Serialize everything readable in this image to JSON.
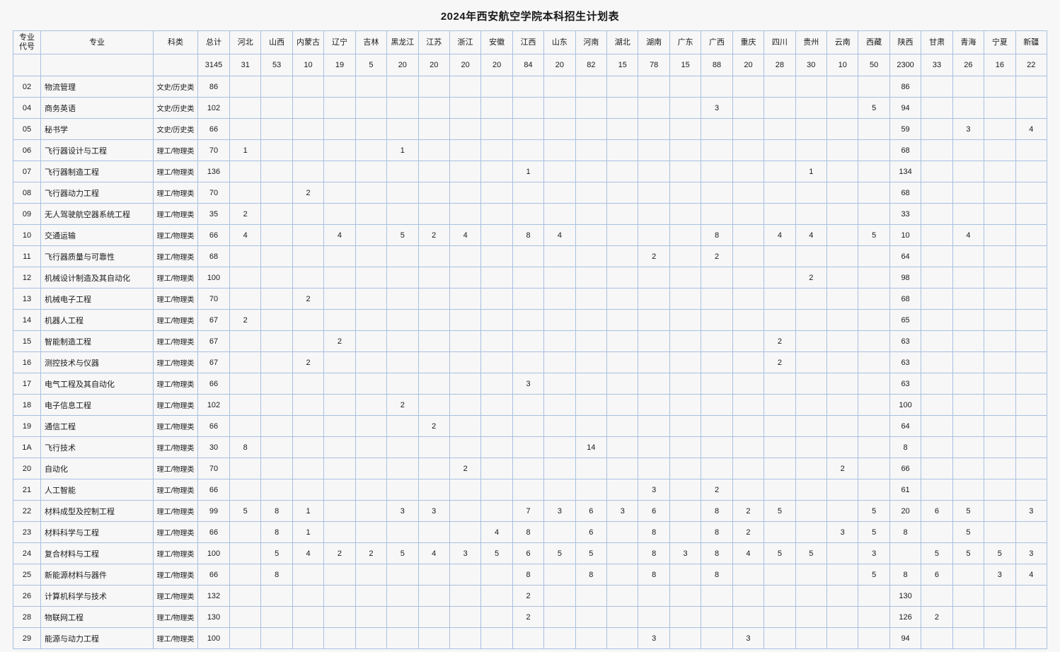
{
  "title": "2024年西安航空学院本科招生计划表",
  "columns": {
    "code": "专业\n代号",
    "code_line1": "专业",
    "code_line2": "代号",
    "major": "专业",
    "category": "科类",
    "total": "总计",
    "provinces": [
      "河北",
      "山西",
      "内蒙古",
      "辽宁",
      "吉林",
      "黑龙江",
      "江苏",
      "浙江",
      "安徽",
      "江西",
      "山东",
      "河南",
      "湖北",
      "湖南",
      "广东",
      "广西",
      "重庆",
      "四川",
      "贵州",
      "云南",
      "西藏",
      "陕西",
      "甘肃",
      "青海",
      "宁夏",
      "新疆"
    ]
  },
  "summary_row": {
    "code": "",
    "major": "",
    "category": "",
    "total": "3145",
    "values": [
      "31",
      "53",
      "10",
      "19",
      "5",
      "20",
      "20",
      "20",
      "20",
      "84",
      "20",
      "82",
      "15",
      "78",
      "15",
      "88",
      "20",
      "28",
      "30",
      "10",
      "50",
      "2300",
      "33",
      "26",
      "16",
      "22"
    ]
  },
  "rows": [
    {
      "code": "02",
      "major": "物流管理",
      "category": "文史/历史类",
      "total": "86",
      "values": [
        "",
        "",
        "",
        "",
        "",
        "",
        "",
        "",
        "",
        "",
        "",
        "",
        "",
        "",
        "",
        "",
        "",
        "",
        "",
        "",
        "",
        "86",
        "",
        "",
        "",
        ""
      ]
    },
    {
      "code": "04",
      "major": "商务英语",
      "category": "文史/历史类",
      "total": "102",
      "values": [
        "",
        "",
        "",
        "",
        "",
        "",
        "",
        "",
        "",
        "",
        "",
        "",
        "",
        "",
        "",
        "3",
        "",
        "",
        "",
        "",
        "5",
        "94",
        "",
        "",
        "",
        ""
      ]
    },
    {
      "code": "05",
      "major": "秘书学",
      "category": "文史/历史类",
      "total": "66",
      "values": [
        "",
        "",
        "",
        "",
        "",
        "",
        "",
        "",
        "",
        "",
        "",
        "",
        "",
        "",
        "",
        "",
        "",
        "",
        "",
        "",
        "",
        "59",
        "",
        "3",
        "",
        "4"
      ]
    },
    {
      "code": "06",
      "major": "飞行器设计与工程",
      "category": "理工/物理类",
      "total": "70",
      "values": [
        "1",
        "",
        "",
        "",
        "",
        "1",
        "",
        "",
        "",
        "",
        "",
        "",
        "",
        "",
        "",
        "",
        "",
        "",
        "",
        "",
        "",
        "68",
        "",
        "",
        "",
        ""
      ]
    },
    {
      "code": "07",
      "major": "飞行器制造工程",
      "category": "理工/物理类",
      "total": "136",
      "values": [
        "",
        "",
        "",
        "",
        "",
        "",
        "",
        "",
        "",
        "1",
        "",
        "",
        "",
        "",
        "",
        "",
        "",
        "",
        "1",
        "",
        "",
        "134",
        "",
        "",
        "",
        ""
      ]
    },
    {
      "code": "08",
      "major": "飞行器动力工程",
      "category": "理工/物理类",
      "total": "70",
      "values": [
        "",
        "",
        "2",
        "",
        "",
        "",
        "",
        "",
        "",
        "",
        "",
        "",
        "",
        "",
        "",
        "",
        "",
        "",
        "",
        "",
        "",
        "68",
        "",
        "",
        "",
        ""
      ]
    },
    {
      "code": "09",
      "major": "无人驾驶航空器系统工程",
      "category": "理工/物理类",
      "total": "35",
      "values": [
        "2",
        "",
        "",
        "",
        "",
        "",
        "",
        "",
        "",
        "",
        "",
        "",
        "",
        "",
        "",
        "",
        "",
        "",
        "",
        "",
        "",
        "33",
        "",
        "",
        "",
        ""
      ]
    },
    {
      "code": "10",
      "major": "交通运输",
      "category": "理工/物理类",
      "total": "66",
      "values": [
        "4",
        "",
        "",
        "4",
        "",
        "5",
        "2",
        "4",
        "",
        "8",
        "4",
        "",
        "",
        "",
        "",
        "8",
        "",
        "4",
        "4",
        "",
        "5",
        "10",
        "",
        "4",
        "",
        ""
      ]
    },
    {
      "code": "11",
      "major": "飞行器质量与可靠性",
      "category": "理工/物理类",
      "total": "68",
      "values": [
        "",
        "",
        "",
        "",
        "",
        "",
        "",
        "",
        "",
        "",
        "",
        "",
        "",
        "2",
        "",
        "2",
        "",
        "",
        "",
        "",
        "",
        "64",
        "",
        "",
        "",
        ""
      ]
    },
    {
      "code": "12",
      "major": "机械设计制造及其自动化",
      "category": "理工/物理类",
      "total": "100",
      "values": [
        "",
        "",
        "",
        "",
        "",
        "",
        "",
        "",
        "",
        "",
        "",
        "",
        "",
        "",
        "",
        "",
        "",
        "",
        "2",
        "",
        "",
        "98",
        "",
        "",
        "",
        ""
      ]
    },
    {
      "code": "13",
      "major": "机械电子工程",
      "category": "理工/物理类",
      "total": "70",
      "values": [
        "",
        "",
        "2",
        "",
        "",
        "",
        "",
        "",
        "",
        "",
        "",
        "",
        "",
        "",
        "",
        "",
        "",
        "",
        "",
        "",
        "",
        "68",
        "",
        "",
        "",
        ""
      ]
    },
    {
      "code": "14",
      "major": "机器人工程",
      "category": "理工/物理类",
      "total": "67",
      "values": [
        "2",
        "",
        "",
        "",
        "",
        "",
        "",
        "",
        "",
        "",
        "",
        "",
        "",
        "",
        "",
        "",
        "",
        "",
        "",
        "",
        "",
        "65",
        "",
        "",
        "",
        ""
      ]
    },
    {
      "code": "15",
      "major": "智能制造工程",
      "category": "理工/物理类",
      "total": "67",
      "values": [
        "",
        "",
        "",
        "2",
        "",
        "",
        "",
        "",
        "",
        "",
        "",
        "",
        "",
        "",
        "",
        "",
        "",
        "2",
        "",
        "",
        "",
        "63",
        "",
        "",
        "",
        ""
      ]
    },
    {
      "code": "16",
      "major": "测控技术与仪器",
      "category": "理工/物理类",
      "total": "67",
      "values": [
        "",
        "",
        "2",
        "",
        "",
        "",
        "",
        "",
        "",
        "",
        "",
        "",
        "",
        "",
        "",
        "",
        "",
        "2",
        "",
        "",
        "",
        "63",
        "",
        "",
        "",
        ""
      ]
    },
    {
      "code": "17",
      "major": "电气工程及其自动化",
      "category": "理工/物理类",
      "total": "66",
      "values": [
        "",
        "",
        "",
        "",
        "",
        "",
        "",
        "",
        "",
        "3",
        "",
        "",
        "",
        "",
        "",
        "",
        "",
        "",
        "",
        "",
        "",
        "63",
        "",
        "",
        "",
        ""
      ]
    },
    {
      "code": "18",
      "major": "电子信息工程",
      "category": "理工/物理类",
      "total": "102",
      "values": [
        "",
        "",
        "",
        "",
        "",
        "2",
        "",
        "",
        "",
        "",
        "",
        "",
        "",
        "",
        "",
        "",
        "",
        "",
        "",
        "",
        "",
        "100",
        "",
        "",
        "",
        ""
      ]
    },
    {
      "code": "19",
      "major": "通信工程",
      "category": "理工/物理类",
      "total": "66",
      "values": [
        "",
        "",
        "",
        "",
        "",
        "",
        "2",
        "",
        "",
        "",
        "",
        "",
        "",
        "",
        "",
        "",
        "",
        "",
        "",
        "",
        "",
        "64",
        "",
        "",
        "",
        ""
      ]
    },
    {
      "code": "1A",
      "major": "飞行技术",
      "category": "理工/物理类",
      "total": "30",
      "values": [
        "8",
        "",
        "",
        "",
        "",
        "",
        "",
        "",
        "",
        "",
        "",
        "14",
        "",
        "",
        "",
        "",
        "",
        "",
        "",
        "",
        "",
        "8",
        "",
        "",
        "",
        ""
      ]
    },
    {
      "code": "20",
      "major": "自动化",
      "category": "理工/物理类",
      "total": "70",
      "values": [
        "",
        "",
        "",
        "",
        "",
        "",
        "",
        "2",
        "",
        "",
        "",
        "",
        "",
        "",
        "",
        "",
        "",
        "",
        "",
        "2",
        "",
        "66",
        "",
        "",
        "",
        ""
      ]
    },
    {
      "code": "21",
      "major": "人工智能",
      "category": "理工/物理类",
      "total": "66",
      "values": [
        "",
        "",
        "",
        "",
        "",
        "",
        "",
        "",
        "",
        "",
        "",
        "",
        "",
        "3",
        "",
        "2",
        "",
        "",
        "",
        "",
        "",
        "61",
        "",
        "",
        "",
        ""
      ]
    },
    {
      "code": "22",
      "major": "材料成型及控制工程",
      "category": "理工/物理类",
      "total": "99",
      "values": [
        "5",
        "8",
        "1",
        "",
        "",
        "3",
        "3",
        "",
        "",
        "7",
        "3",
        "6",
        "3",
        "6",
        "",
        "8",
        "2",
        "5",
        "",
        "",
        "5",
        "20",
        "6",
        "5",
        "",
        "3"
      ]
    },
    {
      "code": "23",
      "major": "材料科学与工程",
      "category": "理工/物理类",
      "total": "66",
      "values": [
        "",
        "8",
        "1",
        "",
        "",
        "",
        "",
        "",
        "4",
        "8",
        "",
        "6",
        "",
        "8",
        "",
        "8",
        "2",
        "",
        "",
        "3",
        "5",
        "8",
        "",
        "5",
        "",
        ""
      ]
    },
    {
      "code": "24",
      "major": "复合材料与工程",
      "category": "理工/物理类",
      "total": "100",
      "values": [
        "",
        "5",
        "4",
        "2",
        "2",
        "5",
        "4",
        "3",
        "5",
        "6",
        "5",
        "5",
        "",
        "8",
        "3",
        "8",
        "4",
        "5",
        "5",
        "",
        "3",
        "",
        "5",
        "5",
        "5",
        "3"
      ]
    },
    {
      "code": "25",
      "major": "新能源材料与器件",
      "category": "理工/物理类",
      "total": "66",
      "values": [
        "",
        "8",
        "",
        "",
        "",
        "",
        "",
        "",
        "",
        "8",
        "",
        "8",
        "",
        "8",
        "",
        "8",
        "",
        "",
        "",
        "",
        "5",
        "8",
        "6",
        "",
        "3",
        "4"
      ]
    },
    {
      "code": "26",
      "major": "计算机科学与技术",
      "category": "理工/物理类",
      "total": "132",
      "values": [
        "",
        "",
        "",
        "",
        "",
        "",
        "",
        "",
        "",
        "2",
        "",
        "",
        "",
        "",
        "",
        "",
        "",
        "",
        "",
        "",
        "",
        "130",
        "",
        "",
        "",
        ""
      ]
    },
    {
      "code": "28",
      "major": "物联网工程",
      "category": "理工/物理类",
      "total": "130",
      "values": [
        "",
        "",
        "",
        "",
        "",
        "",
        "",
        "",
        "",
        "2",
        "",
        "",
        "",
        "",
        "",
        "",
        "",
        "",
        "",
        "",
        "",
        "126",
        "2",
        "",
        "",
        ""
      ]
    },
    {
      "code": "29",
      "major": "能源与动力工程",
      "category": "理工/物理类",
      "total": "100",
      "values": [
        "",
        "",
        "",
        "",
        "",
        "",
        "",
        "",
        "",
        "",
        "",
        "",
        "",
        "3",
        "",
        "",
        "3",
        "",
        "",
        "",
        "",
        "94",
        "",
        "",
        "",
        ""
      ]
    }
  ],
  "colors": {
    "border": "#a9c0e0",
    "background": "#f7f7f7",
    "text": "#1a1a1a"
  }
}
